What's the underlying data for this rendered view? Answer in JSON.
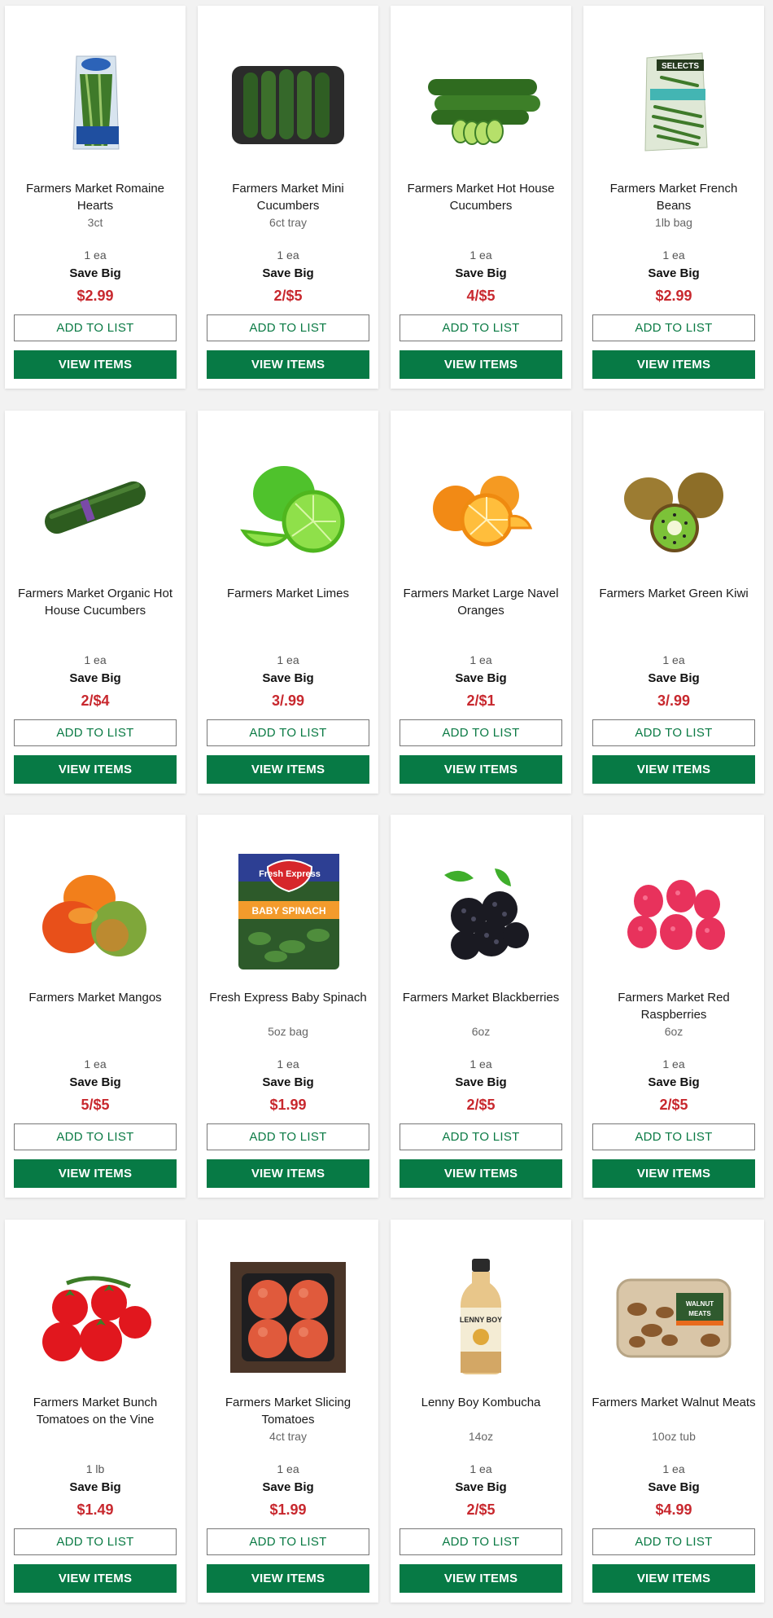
{
  "colors": {
    "accent_green": "#077a45",
    "price_red": "#c8282e",
    "page_background": "#f2f2f2"
  },
  "add_label": "ADD TO LIST",
  "view_label": "VIEW ITEMS",
  "products": [
    {
      "name": "Farmers Market Romaine Hearts",
      "size": "3ct",
      "unit": "1 ea",
      "promo": "Save Big",
      "price": "$2.99",
      "image_icon": "romaine-hearts-image"
    },
    {
      "name": "Farmers Market Mini Cucumbers",
      "size": "6ct tray",
      "unit": "1 ea",
      "promo": "Save Big",
      "price": "2/$5",
      "image_icon": "mini-cucumbers-image"
    },
    {
      "name": "Farmers Market Hot House Cucumbers",
      "size": "",
      "unit": "1 ea",
      "promo": "Save Big",
      "price": "4/$5",
      "image_icon": "hot-house-cucumbers-image"
    },
    {
      "name": "Farmers Market French Beans",
      "size": "1lb bag",
      "unit": "1 ea",
      "promo": "Save Big",
      "price": "$2.99",
      "image_icon": "french-beans-image"
    },
    {
      "name": "Farmers Market Organic Hot House Cucumbers",
      "size": "",
      "unit": "1 ea",
      "promo": "Save Big",
      "price": "2/$4",
      "image_icon": "organic-cucumber-image"
    },
    {
      "name": "Farmers Market Limes",
      "size": "",
      "unit": "1 ea",
      "promo": "Save Big",
      "price": "3/.99",
      "image_icon": "limes-image"
    },
    {
      "name": "Farmers Market Large Navel Oranges",
      "size": "",
      "unit": "1 ea",
      "promo": "Save Big",
      "price": "2/$1",
      "image_icon": "navel-oranges-image"
    },
    {
      "name": "Farmers Market Green Kiwi",
      "size": "",
      "unit": "1 ea",
      "promo": "Save Big",
      "price": "3/.99",
      "image_icon": "green-kiwi-image"
    },
    {
      "name": "Farmers Market Mangos",
      "size": "",
      "unit": "1 ea",
      "promo": "Save Big",
      "price": "5/$5",
      "image_icon": "mangos-image"
    },
    {
      "name": "Fresh Express Baby Spinach",
      "size": "5oz bag",
      "unit": "1 ea",
      "promo": "Save Big",
      "price": "$1.99",
      "image_icon": "baby-spinach-image"
    },
    {
      "name": "Farmers Market Blackberries",
      "size": "6oz",
      "unit": "1 ea",
      "promo": "Save Big",
      "price": "2/$5",
      "image_icon": "blackberries-image"
    },
    {
      "name": "Farmers Market Red Raspberries",
      "size": "6oz",
      "unit": "1 ea",
      "promo": "Save Big",
      "price": "2/$5",
      "image_icon": "raspberries-image"
    },
    {
      "name": "Farmers Market Bunch Tomatoes on the Vine",
      "size": "",
      "unit": "1 lb",
      "promo": "Save Big",
      "price": "$1.49",
      "image_icon": "vine-tomatoes-image"
    },
    {
      "name": "Farmers Market Slicing Tomatoes",
      "size": "4ct tray",
      "unit": "1 ea",
      "promo": "Save Big",
      "price": "$1.99",
      "image_icon": "slicing-tomatoes-image"
    },
    {
      "name": "Lenny Boy Kombucha",
      "size": "14oz",
      "unit": "1 ea",
      "promo": "Save Big",
      "price": "2/$5",
      "image_icon": "kombucha-bottle-image"
    },
    {
      "name": "Farmers Market Walnut Meats",
      "size": "10oz tub",
      "unit": "1 ea",
      "promo": "Save Big",
      "price": "$4.99",
      "image_icon": "walnut-meats-image"
    }
  ],
  "brand_text": {
    "spinach_brand": "Fresh Express",
    "spinach_banner": "BABY SPINACH",
    "kombucha_brand": "LENNY BOY",
    "walnut_label": "WALNUT MEATS",
    "beans_brand": "SELECTS"
  }
}
